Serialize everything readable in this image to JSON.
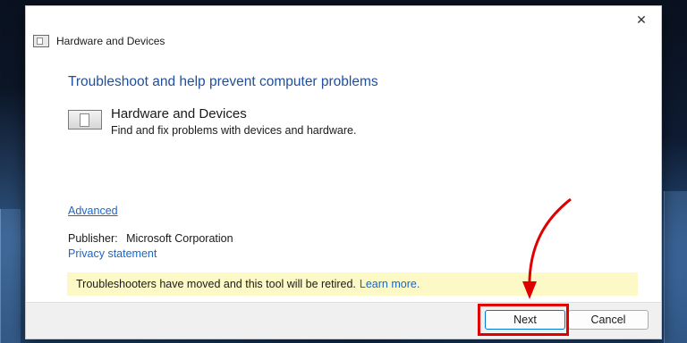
{
  "dialog": {
    "title": "Hardware and Devices",
    "heading": "Troubleshoot and help prevent computer problems",
    "item": {
      "title": "Hardware and Devices",
      "description": "Find and fix problems with devices and hardware."
    },
    "advanced_link": "Advanced",
    "publisher_label": "Publisher:",
    "publisher_value": "Microsoft Corporation",
    "privacy_link": "Privacy statement",
    "banner": {
      "text": "Troubleshooters have moved and this tool will be retired.",
      "link": "Learn more."
    },
    "buttons": {
      "next": "Next",
      "cancel": "Cancel"
    },
    "close_glyph": "✕"
  },
  "colors": {
    "heading": "#1f4e9c",
    "link": "#1a66c9",
    "banner_bg": "#fdf9c6",
    "annotation": "#e00000"
  },
  "icons": {
    "title": "troubleshooter-app-icon",
    "item": "hardware-device-icon",
    "close": "close-icon"
  }
}
